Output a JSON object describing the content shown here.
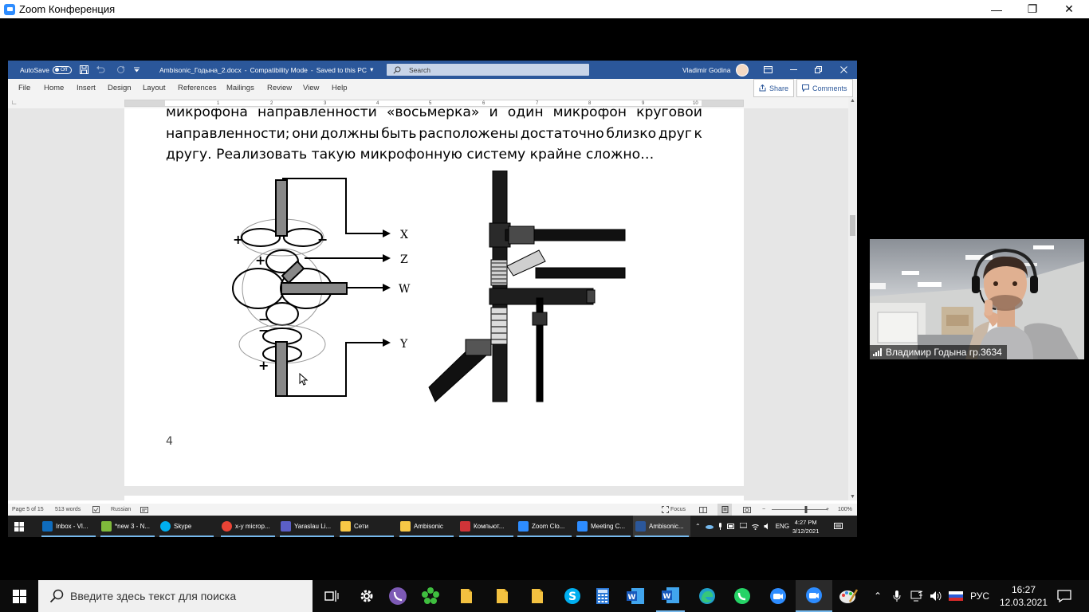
{
  "zoom": {
    "title": "Zoom Конференция",
    "window_controls": {
      "minimize": "—",
      "restore": "❐",
      "close": "✕"
    }
  },
  "word": {
    "autosave_label": "AutoSave",
    "autosave_state": "Off",
    "doc_title": "Ambisonic_Годына_2.docx",
    "title_sep": "-",
    "compat_mode": "Compatibility Mode",
    "saved_status": "Saved to this PC",
    "search_placeholder": "Search",
    "user_name": "Vladimir Godina",
    "menu": [
      "File",
      "Home",
      "Insert",
      "Design",
      "Layout",
      "References",
      "Mailings",
      "Review",
      "View",
      "Help"
    ],
    "share_label": "Share",
    "comments_label": "Comments",
    "ruler_numbers": [
      "1",
      "2",
      "3",
      "4",
      "5",
      "6",
      "7",
      "8",
      "9",
      "10"
    ],
    "text_lines": [
      [
        "микрофона",
        "направленности",
        "«восьмерка»",
        "и",
        "один",
        "микрофон",
        "круговой"
      ],
      [
        "направленности;",
        "они",
        "должны",
        "быть",
        "расположены",
        "достаточно",
        "близко",
        "друг",
        "к"
      ],
      [
        "другу. Реализовать такую микрофонную систему крайне сложно…"
      ]
    ],
    "diagram_labels": {
      "x": "X",
      "z": "Z",
      "w": "W",
      "y": "Y",
      "plus": "+",
      "minus": "−"
    },
    "page_number": "4",
    "status": {
      "page": "Page 5 of 15",
      "words": "513 words",
      "language": "Russian",
      "focus": "Focus",
      "zoom_minus": "−",
      "zoom_plus": "+",
      "zoom_level": "100%",
      "zoom_level_fraction": 0.62
    },
    "inner_taskbar": {
      "items": [
        {
          "label": "Inbox - Vl...",
          "color": "#0f6cbd"
        },
        {
          "label": "*new 3 - N...",
          "color": "#7fba3b"
        },
        {
          "label": "Skype",
          "color": "#00aff0"
        },
        {
          "label": "x-y microp...",
          "color": "#ea4335"
        },
        {
          "label": "Yaraslau Li...",
          "color": "#5b5fc7"
        },
        {
          "label": "Сети",
          "color": "#f8c846"
        },
        {
          "label": "Ambisonic",
          "color": "#f8c846"
        },
        {
          "label": "Компьют...",
          "color": "#d13438"
        },
        {
          "label": "Zoom Clo...",
          "color": "#2d8cff"
        },
        {
          "label": "Meeting C...",
          "color": "#2d8cff"
        },
        {
          "label": "Ambisonic...",
          "color": "#2b579a"
        }
      ],
      "lang": "ENG",
      "time": "4:27 PM",
      "date": "3/12/2021"
    }
  },
  "video": {
    "participant": "Владимир Годына  гр.3634"
  },
  "taskbar": {
    "search_placeholder": "Введите здесь текст для поиска",
    "lang": "РУС",
    "time": "16:27",
    "date": "12.03.2021"
  },
  "colors": {
    "word_blue": "#2b579a",
    "zoom_blue": "#2d8cff",
    "taskbar": "#0c0c0c"
  }
}
